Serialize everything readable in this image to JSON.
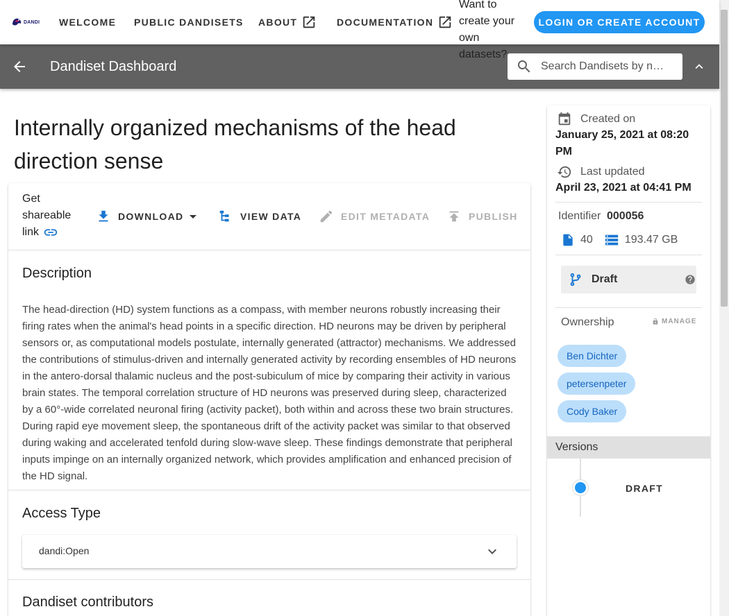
{
  "nav": {
    "logo_text": "DANDI",
    "items": [
      "Welcome",
      "Public Dandisets",
      "About",
      "Documentation"
    ],
    "want_text": "Want to create your own datasets?",
    "login_label": "Login or Create Account"
  },
  "toolbar": {
    "title": "Dandiset Dashboard",
    "search_placeholder": "Search Dandisets by name, description, identifier, or contributor name"
  },
  "dandiset": {
    "title": "Internally organized mechanisms of the head direction sense",
    "actions": {
      "share_label": "Get shareable link",
      "download_label": "Download",
      "view_data_label": "View Data",
      "edit_metadata_label": "Edit Metadata",
      "publish_label": "Publish"
    },
    "description_title": "Description",
    "description": "The head-direction (HD) system functions as a compass, with member neurons robustly increasing their firing rates when the animal's head points in a specific direction. HD neurons may be driven by peripheral sensors or, as computational models postulate, internally generated (attractor) mechanisms. We addressed the contributions of stimulus-driven and internally generated activity by recording ensembles of HD neurons in the antero-dorsal thalamic nucleus and the post-subiculum of mice by comparing their activity in various brain states. The temporal correlation structure of HD neurons was preserved during sleep, characterized by a 60°-wide correlated neuronal firing (activity packet), both within and across these two brain structures. During rapid eye movement sleep, the spontaneous drift of the activity packet was similar to that observed during waking and accelerated tenfold during slow-wave sleep. These findings demonstrate that peripheral inputs impinge on an internally organized network, which provides amplification and enhanced precision of the HD signal.",
    "access_title": "Access Type",
    "access_value": "dandi:Open",
    "contributors_title": "Dandiset contributors"
  },
  "sidebar": {
    "created_label": "Created on",
    "created_value": "January 25, 2021 at 08:20 PM",
    "updated_label": "Last updated",
    "updated_value": "April 23, 2021 at 04:41 PM",
    "identifier_label": "Identifier",
    "identifier_value": "000056",
    "file_count": "40",
    "size": "193.47 GB",
    "version_status": "Draft",
    "ownership_label": "Ownership",
    "manage_label": "Manage",
    "owners": [
      "Ben Dichter",
      "petersenpeter",
      "Cody Baker"
    ],
    "versions_label": "Versions",
    "versions": [
      "Draft"
    ]
  },
  "colors": {
    "primary": "#2196f3",
    "toolbar": "#616161",
    "chip_bg": "#bbdefb",
    "chip_text": "#1565c0"
  }
}
